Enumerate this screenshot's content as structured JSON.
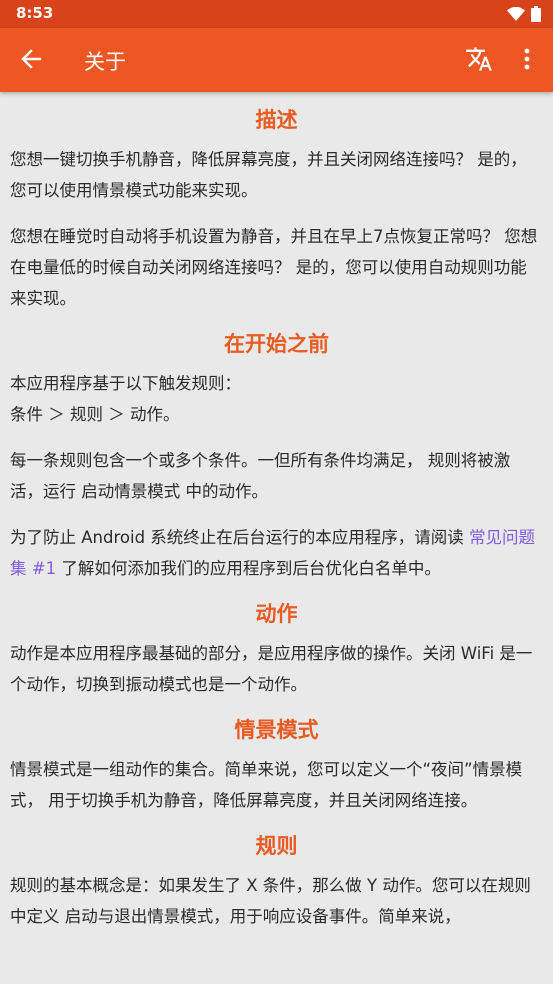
{
  "status_bar": {
    "time": "8:53"
  },
  "app_bar": {
    "title": "关于"
  },
  "sections": {
    "description": {
      "heading": "描述",
      "p1": "您想一键切换手机静音，降低屏幕亮度，并且关闭网络连接吗？ 是的，您可以使用情景模式功能来实现。",
      "p2": "您想在睡觉时自动将手机设置为静音，并且在早上7点恢复正常吗？ 您想在电量低的时候自动关闭网络连接吗？ 是的，您可以使用自动规则功能来实现。"
    },
    "before_start": {
      "heading": "在开始之前",
      "p1_line1": "本应用程序基于以下触发规则：",
      "p1_line2": "条件 ＞ 规则 ＞ 动作。",
      "p2": "每一条规则包含一个或多个条件。一但所有条件均满足， 规则将被激活，运行 启动情景模式 中的动作。",
      "p3_prefix": "为了防止 Android 系统终止在后台运行的本应用程序，请阅读 ",
      "p3_link": "常见问题集 #1",
      "p3_suffix": " 了解如何添加我们的应用程序到后台优化白名单中。"
    },
    "actions": {
      "heading": "动作",
      "p1": "动作是本应用程序最基础的部分，是应用程序做的操作。关闭 WiFi 是一个动作，切换到振动模式也是一个动作。"
    },
    "profiles": {
      "heading": "情景模式",
      "p1": "情景模式是一组动作的集合。简单来说，您可以定义一个“夜间”情景模式， 用于切换手机为静音，降低屏幕亮度，并且关闭网络连接。"
    },
    "rules": {
      "heading": "规则",
      "p1": "规则的基本概念是：如果发生了 X 条件，那么做 Y 动作。您可以在规则中定义 启动与退出情景模式，用于响应设备事件。简单来说，"
    }
  },
  "colors": {
    "appbar": "#ee5624",
    "statusbar": "#d8431a",
    "heading": "#e95b22",
    "link": "#7c5ce8",
    "background": "#e9e9e9"
  },
  "icons": [
    "wifi-icon",
    "battery-icon",
    "back-arrow-icon",
    "translate-icon",
    "more-vert-icon"
  ]
}
